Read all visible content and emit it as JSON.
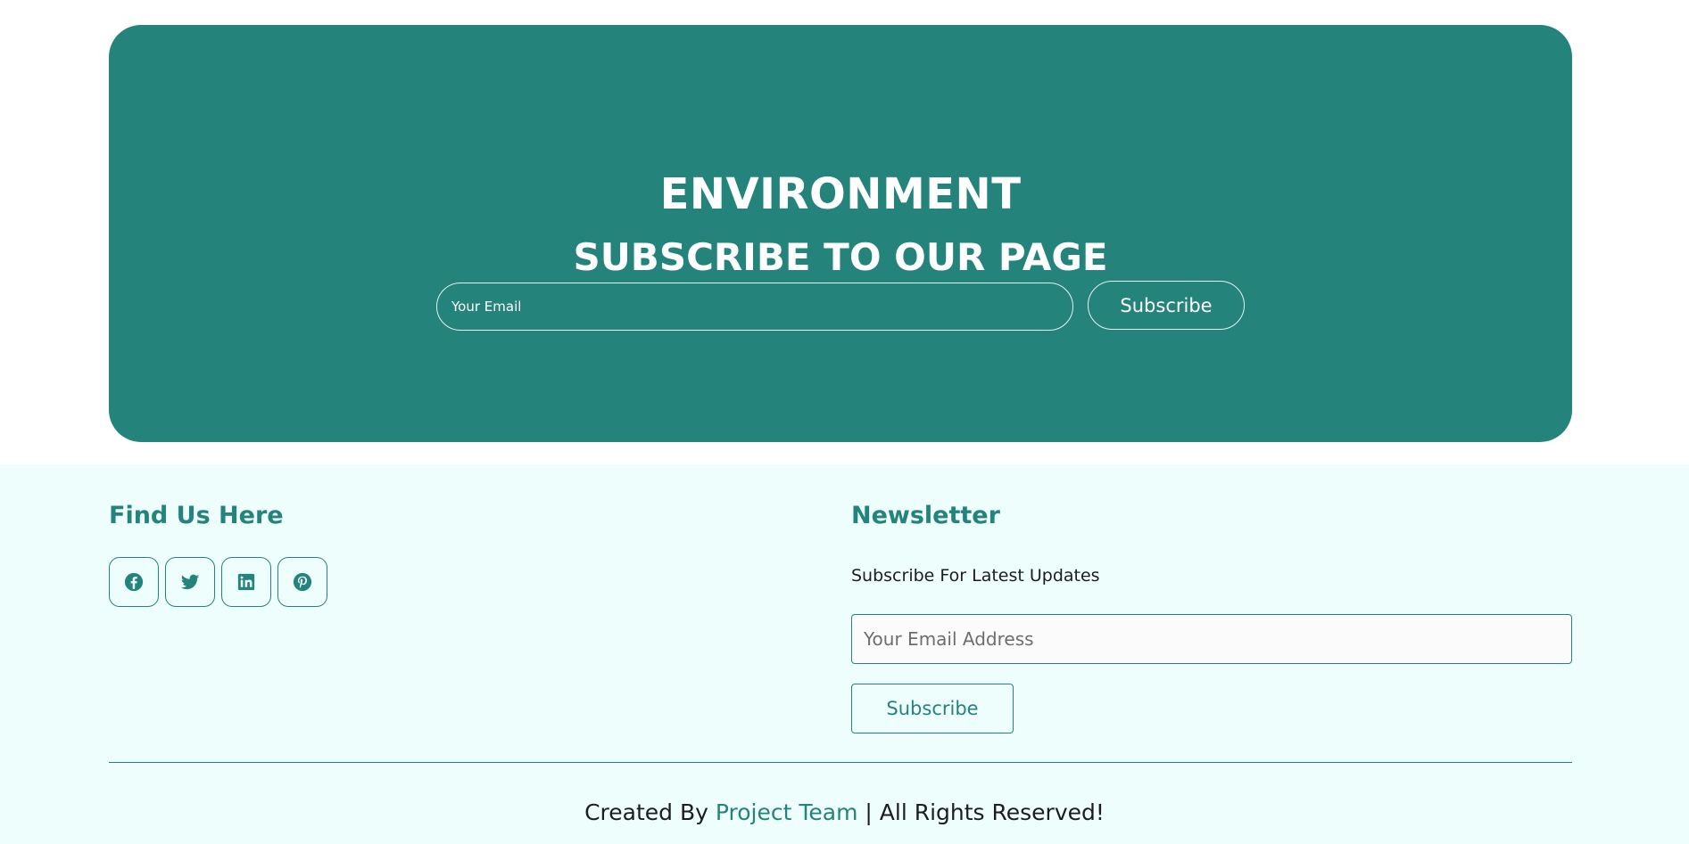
{
  "hero": {
    "title": "ENVIRONMENT",
    "subtitle": "SUBSCRIBE TO OUR PAGE",
    "email_placeholder": "Your Email",
    "subscribe_label": "Subscribe"
  },
  "footer": {
    "find_us": {
      "heading": "Find Us Here",
      "socials": [
        {
          "icon": "facebook-icon"
        },
        {
          "icon": "twitter-icon"
        },
        {
          "icon": "linkedin-icon"
        },
        {
          "icon": "pinterest-icon"
        }
      ]
    },
    "newsletter": {
      "heading": "Newsletter",
      "text": "Subscribe For Latest Updates",
      "email_placeholder": "Your Email Address",
      "subscribe_label": "Subscribe"
    },
    "credits": {
      "prefix": "Created By",
      "team": "Project Team",
      "suffix": "| All Rights Reserved!"
    }
  },
  "colors": {
    "accent": "#24837a",
    "footer_background": "#edfefc",
    "text": "#1d1d1d"
  }
}
